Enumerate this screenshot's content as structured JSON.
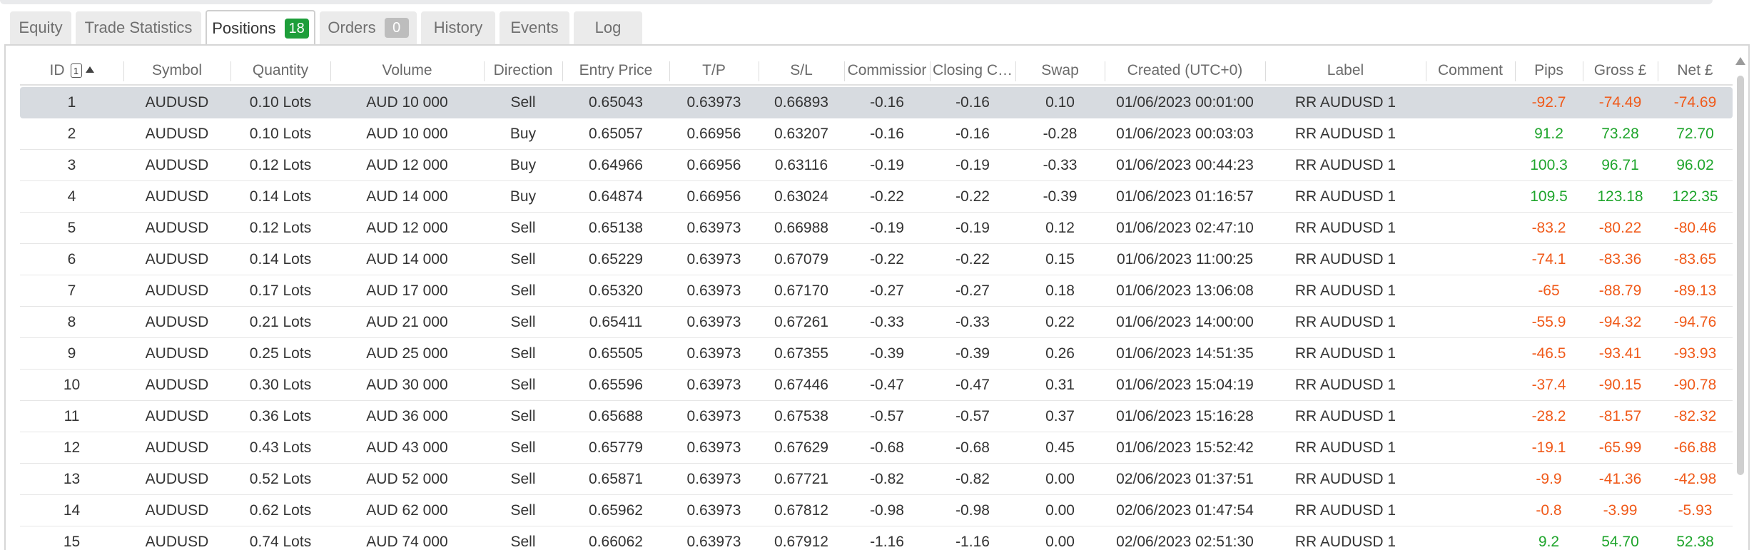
{
  "tabs": [
    {
      "label": "Equity"
    },
    {
      "label": "Trade Statistics"
    },
    {
      "label": "Positions",
      "badge": "18"
    },
    {
      "label": "Orders",
      "badge": "0"
    },
    {
      "label": "History"
    },
    {
      "label": "Events"
    },
    {
      "label": "Log"
    }
  ],
  "columns": {
    "id": "ID",
    "sort_index": "1",
    "symbol": "Symbol",
    "quantity": "Quantity",
    "volume": "Volume",
    "direction": "Direction",
    "entry": "Entry Price",
    "tp": "T/P",
    "sl": "S/L",
    "commission": "Commissior",
    "closing": "Closing C…",
    "swap": "Swap",
    "created": "Created (UTC+0)",
    "label": "Label",
    "comment": "Comment",
    "pips": "Pips",
    "gross": "Gross £",
    "net": "Net £"
  },
  "rows": [
    {
      "id": "1",
      "symbol": "AUDUSD",
      "quantity": "0.10 Lots",
      "volume": "AUD 10 000",
      "direction": "Sell",
      "entry": "0.65043",
      "tp": "0.63973",
      "sl": "0.66893",
      "commission": "-0.16",
      "closing": "-0.16",
      "swap": "0.10",
      "created": "01/06/2023 00:01:00",
      "label": "RR AUDUSD 1",
      "comment": "",
      "pips": "-92.7",
      "gross": "-74.49",
      "net": "-74.69"
    },
    {
      "id": "2",
      "symbol": "AUDUSD",
      "quantity": "0.10 Lots",
      "volume": "AUD 10 000",
      "direction": "Buy",
      "entry": "0.65057",
      "tp": "0.66956",
      "sl": "0.63207",
      "commission": "-0.16",
      "closing": "-0.16",
      "swap": "-0.28",
      "created": "01/06/2023 00:03:03",
      "label": "RR AUDUSD 1",
      "comment": "",
      "pips": "91.2",
      "gross": "73.28",
      "net": "72.70"
    },
    {
      "id": "3",
      "symbol": "AUDUSD",
      "quantity": "0.12 Lots",
      "volume": "AUD 12 000",
      "direction": "Buy",
      "entry": "0.64966",
      "tp": "0.66956",
      "sl": "0.63116",
      "commission": "-0.19",
      "closing": "-0.19",
      "swap": "-0.33",
      "created": "01/06/2023 00:44:23",
      "label": "RR AUDUSD 1",
      "comment": "",
      "pips": "100.3",
      "gross": "96.71",
      "net": "96.02"
    },
    {
      "id": "4",
      "symbol": "AUDUSD",
      "quantity": "0.14 Lots",
      "volume": "AUD 14 000",
      "direction": "Buy",
      "entry": "0.64874",
      "tp": "0.66956",
      "sl": "0.63024",
      "commission": "-0.22",
      "closing": "-0.22",
      "swap": "-0.39",
      "created": "01/06/2023 01:16:57",
      "label": "RR AUDUSD 1",
      "comment": "",
      "pips": "109.5",
      "gross": "123.18",
      "net": "122.35"
    },
    {
      "id": "5",
      "symbol": "AUDUSD",
      "quantity": "0.12 Lots",
      "volume": "AUD 12 000",
      "direction": "Sell",
      "entry": "0.65138",
      "tp": "0.63973",
      "sl": "0.66988",
      "commission": "-0.19",
      "closing": "-0.19",
      "swap": "0.12",
      "created": "01/06/2023 02:47:10",
      "label": "RR AUDUSD 1",
      "comment": "",
      "pips": "-83.2",
      "gross": "-80.22",
      "net": "-80.46"
    },
    {
      "id": "6",
      "symbol": "AUDUSD",
      "quantity": "0.14 Lots",
      "volume": "AUD 14 000",
      "direction": "Sell",
      "entry": "0.65229",
      "tp": "0.63973",
      "sl": "0.67079",
      "commission": "-0.22",
      "closing": "-0.22",
      "swap": "0.15",
      "created": "01/06/2023 11:00:25",
      "label": "RR AUDUSD 1",
      "comment": "",
      "pips": "-74.1",
      "gross": "-83.36",
      "net": "-83.65"
    },
    {
      "id": "7",
      "symbol": "AUDUSD",
      "quantity": "0.17 Lots",
      "volume": "AUD 17 000",
      "direction": "Sell",
      "entry": "0.65320",
      "tp": "0.63973",
      "sl": "0.67170",
      "commission": "-0.27",
      "closing": "-0.27",
      "swap": "0.18",
      "created": "01/06/2023 13:06:08",
      "label": "RR AUDUSD 1",
      "comment": "",
      "pips": "-65",
      "gross": "-88.79",
      "net": "-89.13"
    },
    {
      "id": "8",
      "symbol": "AUDUSD",
      "quantity": "0.21 Lots",
      "volume": "AUD 21 000",
      "direction": "Sell",
      "entry": "0.65411",
      "tp": "0.63973",
      "sl": "0.67261",
      "commission": "-0.33",
      "closing": "-0.33",
      "swap": "0.22",
      "created": "01/06/2023 14:00:00",
      "label": "RR AUDUSD 1",
      "comment": "",
      "pips": "-55.9",
      "gross": "-94.32",
      "net": "-94.76"
    },
    {
      "id": "9",
      "symbol": "AUDUSD",
      "quantity": "0.25 Lots",
      "volume": "AUD 25 000",
      "direction": "Sell",
      "entry": "0.65505",
      "tp": "0.63973",
      "sl": "0.67355",
      "commission": "-0.39",
      "closing": "-0.39",
      "swap": "0.26",
      "created": "01/06/2023 14:51:35",
      "label": "RR AUDUSD 1",
      "comment": "",
      "pips": "-46.5",
      "gross": "-93.41",
      "net": "-93.93"
    },
    {
      "id": "10",
      "symbol": "AUDUSD",
      "quantity": "0.30 Lots",
      "volume": "AUD 30 000",
      "direction": "Sell",
      "entry": "0.65596",
      "tp": "0.63973",
      "sl": "0.67446",
      "commission": "-0.47",
      "closing": "-0.47",
      "swap": "0.31",
      "created": "01/06/2023 15:04:19",
      "label": "RR AUDUSD 1",
      "comment": "",
      "pips": "-37.4",
      "gross": "-90.15",
      "net": "-90.78"
    },
    {
      "id": "11",
      "symbol": "AUDUSD",
      "quantity": "0.36 Lots",
      "volume": "AUD 36 000",
      "direction": "Sell",
      "entry": "0.65688",
      "tp": "0.63973",
      "sl": "0.67538",
      "commission": "-0.57",
      "closing": "-0.57",
      "swap": "0.37",
      "created": "01/06/2023 15:16:28",
      "label": "RR AUDUSD 1",
      "comment": "",
      "pips": "-28.2",
      "gross": "-81.57",
      "net": "-82.32"
    },
    {
      "id": "12",
      "symbol": "AUDUSD",
      "quantity": "0.43 Lots",
      "volume": "AUD 43 000",
      "direction": "Sell",
      "entry": "0.65779",
      "tp": "0.63973",
      "sl": "0.67629",
      "commission": "-0.68",
      "closing": "-0.68",
      "swap": "0.45",
      "created": "01/06/2023 15:52:42",
      "label": "RR AUDUSD 1",
      "comment": "",
      "pips": "-19.1",
      "gross": "-65.99",
      "net": "-66.88"
    },
    {
      "id": "13",
      "symbol": "AUDUSD",
      "quantity": "0.52 Lots",
      "volume": "AUD 52 000",
      "direction": "Sell",
      "entry": "0.65871",
      "tp": "0.63973",
      "sl": "0.67721",
      "commission": "-0.82",
      "closing": "-0.82",
      "swap": "0.00",
      "created": "02/06/2023 01:37:51",
      "label": "RR AUDUSD 1",
      "comment": "",
      "pips": "-9.9",
      "gross": "-41.36",
      "net": "-42.98"
    },
    {
      "id": "14",
      "symbol": "AUDUSD",
      "quantity": "0.62 Lots",
      "volume": "AUD 62 000",
      "direction": "Sell",
      "entry": "0.65962",
      "tp": "0.63973",
      "sl": "0.67812",
      "commission": "-0.98",
      "closing": "-0.98",
      "swap": "0.00",
      "created": "02/06/2023 01:47:54",
      "label": "RR AUDUSD 1",
      "comment": "",
      "pips": "-0.8",
      "gross": "-3.99",
      "net": "-5.93"
    },
    {
      "id": "15",
      "symbol": "AUDUSD",
      "quantity": "0.74 Lots",
      "volume": "AUD 74 000",
      "direction": "Sell",
      "entry": "0.66062",
      "tp": "0.63973",
      "sl": "0.67912",
      "commission": "-1.16",
      "closing": "-1.16",
      "swap": "0.00",
      "created": "02/06/2023 02:51:30",
      "label": "RR AUDUSD 1",
      "comment": "",
      "pips": "9.2",
      "gross": "54.70",
      "net": "52.38"
    }
  ],
  "colors": {
    "negative": "#f05a1a",
    "positive": "#1fa52c",
    "badge_green": "#1e9e3a",
    "badge_gray": "#bdbdbd",
    "selected_row": "#d7dbe0"
  },
  "icons": {
    "sort": "sort-ascending-icon",
    "scroll_up": "scroll-up-arrow-icon"
  }
}
